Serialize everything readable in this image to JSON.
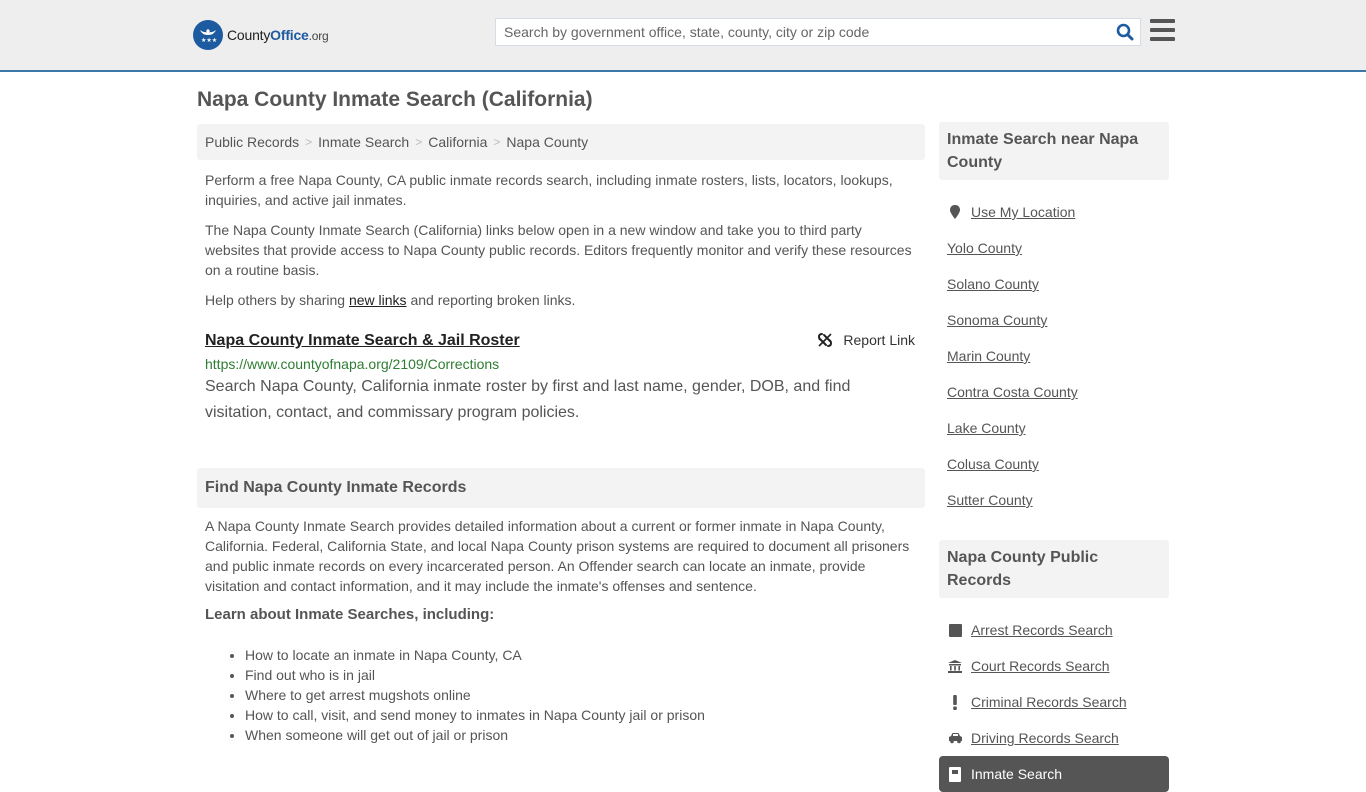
{
  "header": {
    "logo": {
      "brand_main": "County",
      "brand_accent": "Office",
      "brand_tld": ".org"
    },
    "search": {
      "placeholder": "Search by government office, state, county, city or zip code",
      "value": ""
    },
    "colors": {
      "accent": "#1d5ba0",
      "header_border": "#3b78a8",
      "header_bg": "#eeeeee"
    }
  },
  "page": {
    "title": "Napa County Inmate Search (California)"
  },
  "breadcrumb": [
    {
      "label": "Public Records"
    },
    {
      "label": "Inmate Search"
    },
    {
      "label": "California"
    },
    {
      "label": "Napa County"
    }
  ],
  "breadcrumb_separator": ">",
  "intro": {
    "p1": "Perform a free Napa County, CA public inmate records search, including inmate rosters, lists, locators, lookups, inquiries, and active jail inmates.",
    "p2": "The Napa County Inmate Search (California) links below open in a new window and take you to third party websites that provide access to Napa County public records. Editors frequently monitor and verify these resources on a routine basis.",
    "p3_before": "Help others by sharing ",
    "p3_link": "new links",
    "p3_after": " and reporting broken links."
  },
  "results": [
    {
      "title": "Napa County Inmate Search & Jail Roster",
      "url": "https://www.countyofnapa.org/2109/Corrections",
      "description": "Search Napa County, California inmate roster by first and last name, gender, DOB, and find visitation, contact, and commissary program policies.",
      "report_label": "Report Link",
      "report_icon": "unlink-icon"
    }
  ],
  "find_section": {
    "heading": "Find Napa County Inmate Records",
    "body": "A Napa County Inmate Search provides detailed information about a current or former inmate in Napa County, California. Federal, California State, and local Napa County prison systems are required to document all prisoners and public inmate records on every incarcerated person. An Offender search can locate an inmate, provide visitation and contact information, and it may include the inmate's offenses and sentence.",
    "learn_heading": "Learn about Inmate Searches, including:",
    "bullets": [
      "How to locate an inmate in Napa County, CA",
      "Find out who is in jail",
      "Where to get arrest mugshots online",
      "How to call, visit, and send money to inmates in Napa County jail or prison",
      "When someone will get out of jail or prison"
    ]
  },
  "sidebar": {
    "nearby_heading": "Inmate Search near Napa County",
    "use_location": {
      "label": "Use My Location",
      "icon": "map-marker-icon"
    },
    "nearby": [
      {
        "label": "Yolo County"
      },
      {
        "label": "Solano County"
      },
      {
        "label": "Sonoma County"
      },
      {
        "label": "Marin County"
      },
      {
        "label": "Contra Costa County"
      },
      {
        "label": "Lake County"
      },
      {
        "label": "Colusa County"
      },
      {
        "label": "Sutter County"
      }
    ],
    "records_heading": "Napa County Public Records",
    "records": [
      {
        "label": "Arrest Records Search",
        "icon": "square-icon",
        "active": false
      },
      {
        "label": "Court Records Search",
        "icon": "courthouse-icon",
        "active": false
      },
      {
        "label": "Criminal Records Search",
        "icon": "exclamation-icon",
        "active": false
      },
      {
        "label": "Driving Records Search",
        "icon": "car-icon",
        "active": false
      },
      {
        "label": "Inmate Search",
        "icon": "cell-door-icon",
        "active": true
      }
    ]
  }
}
